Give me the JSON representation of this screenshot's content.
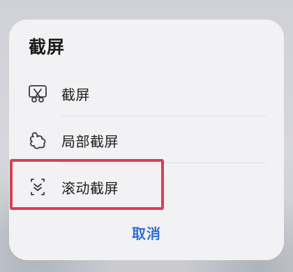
{
  "dialog": {
    "title": "截屏",
    "options": [
      {
        "label": "截屏",
        "icon": "scissors-screenshot-icon"
      },
      {
        "label": "局部截屏",
        "icon": "partial-shape-icon"
      },
      {
        "label": "滚动截屏",
        "icon": "scroll-capture-icon"
      }
    ],
    "cancel_label": "取消"
  },
  "colors": {
    "sheet_background": "#f2f2f4",
    "accent": "#2f6ed8",
    "highlight": "#d64054",
    "text": "#1d1d1d"
  }
}
